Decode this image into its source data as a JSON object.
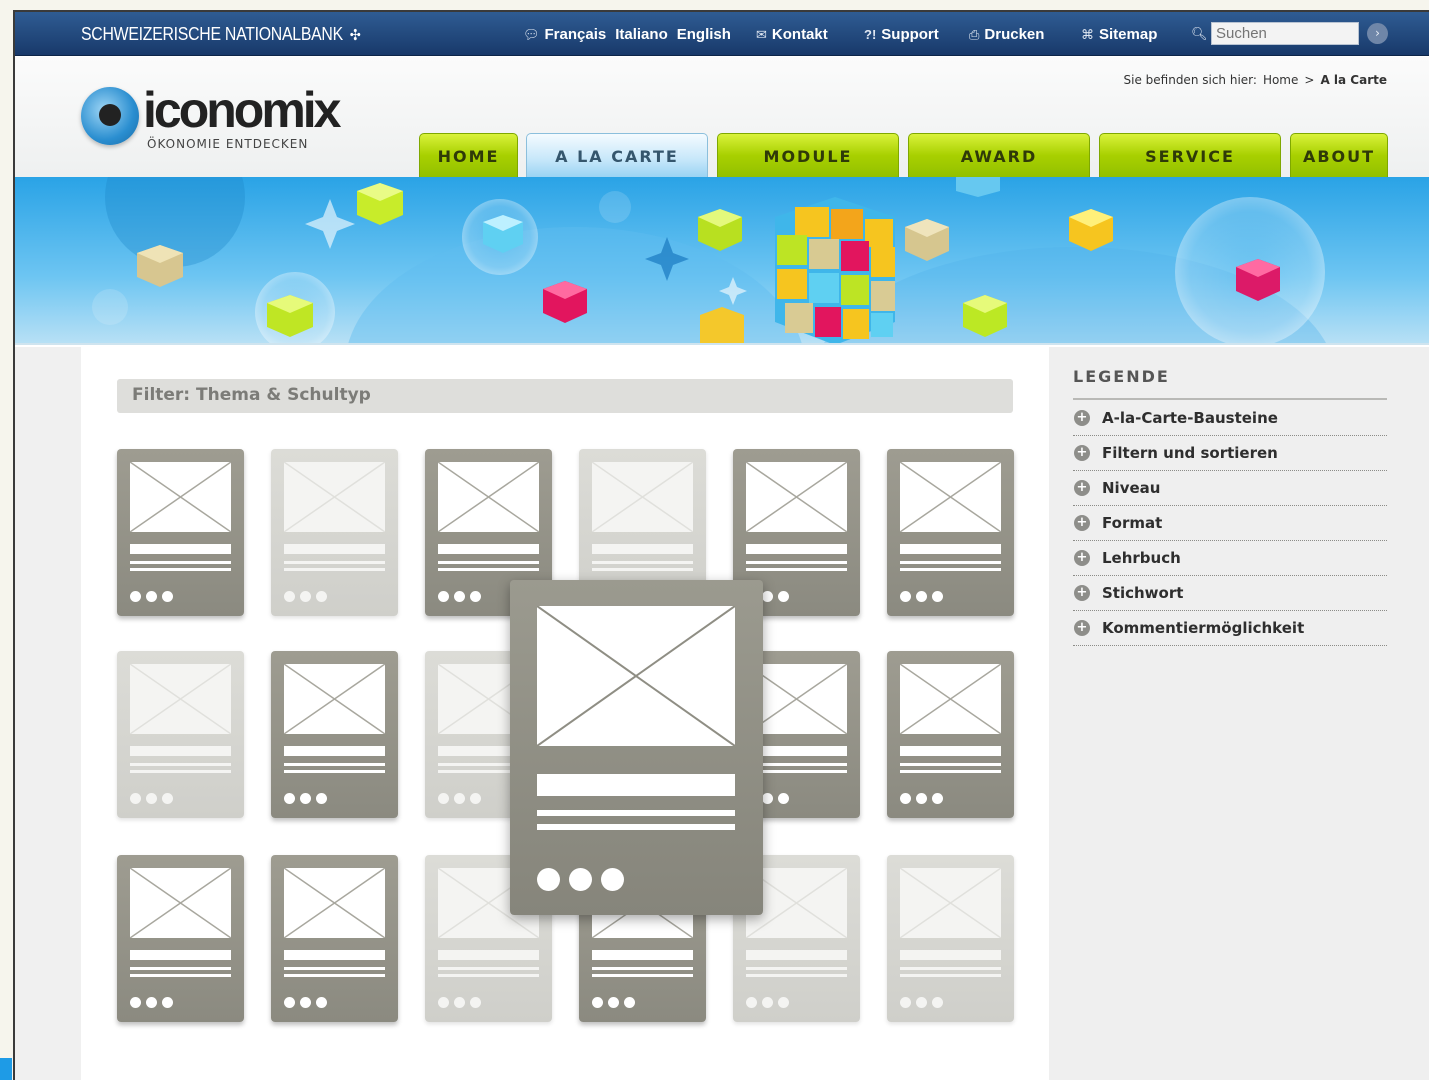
{
  "topbar": {
    "brand": "SCHWEIZERISCHE NATIONALBANK",
    "brand_icon": "swiss-cross-icon",
    "languages": [
      "Français",
      "Italiano",
      "English"
    ],
    "links": {
      "kontakt": "Kontakt",
      "support": "Support",
      "drucken": "Drucken",
      "sitemap": "Sitemap"
    },
    "search": {
      "placeholder": "Suchen"
    }
  },
  "breadcrumb": {
    "prefix": "Sie befinden sich hier:",
    "home": "Home",
    "separator": ">",
    "current": "A la Carte"
  },
  "logo": {
    "wordmark": "iconomix",
    "tagline": "ÖKONOMIE ENTDECKEN"
  },
  "nav": {
    "tabs": [
      "HOME",
      "A LA CARTE",
      "MODULE",
      "AWARD",
      "SERVICE",
      "ABOUT"
    ],
    "active": "A LA CARTE"
  },
  "main": {
    "filter_label": "Filter: Thema & Schultyp"
  },
  "sidebar": {
    "title": "LEGENDE",
    "items": [
      "A-la-Carte-Bausteine",
      "Filtern und sortieren",
      "Niveau",
      "Format",
      "Lehrbuch",
      "Stichwort",
      "Kommentiermöglichkeit"
    ]
  },
  "colors": {
    "topbar": "#18396a",
    "nav_green": "#a8d000",
    "nav_active": "#c6e7fa",
    "card_dark": "#8b8a80",
    "card_faded": "#cfcfca"
  }
}
